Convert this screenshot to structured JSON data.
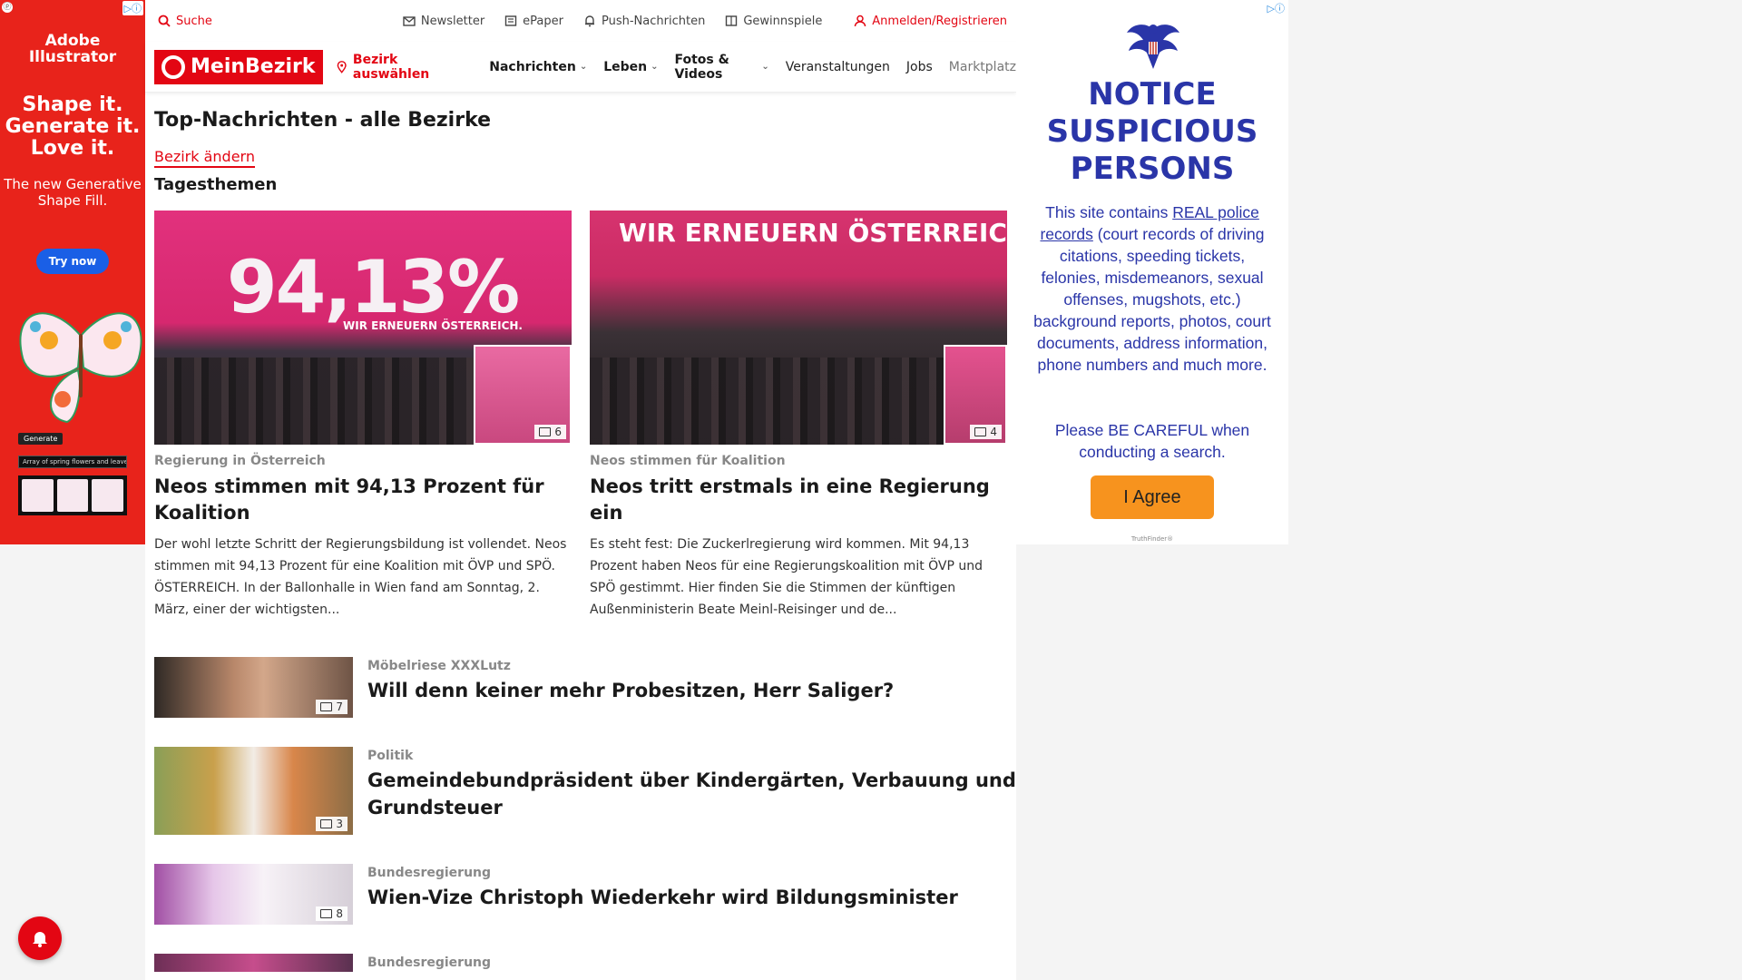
{
  "left_ad": {
    "adchoice": "▷ⓘ",
    "brand_line1": "Adobe",
    "brand_line2": "Illustrator",
    "headline": "Shape it. Generate it. Love it.",
    "sub": "The new Generative Shape Fill.",
    "cta": "Try now",
    "generate": "Generate",
    "prompt": "Array of spring flowers and leaves"
  },
  "utility": {
    "search": "Suche",
    "newsletter": "Newsletter",
    "epaper": "ePaper",
    "push": "Push-Nachrichten",
    "gewinnspiele": "Gewinnspiele",
    "login": "Anmelden/Registrieren"
  },
  "nav": {
    "logo": "MeinBezirk",
    "bezirk": "Bezirk auswählen",
    "items": [
      {
        "label": "Nachrichten"
      },
      {
        "label": "Leben"
      },
      {
        "label": "Fotos & Videos"
      },
      {
        "label": "Veranstaltungen"
      },
      {
        "label": "Jobs"
      },
      {
        "label": "Marktplatz"
      }
    ]
  },
  "main": {
    "title": "Top-Nachrichten - alle Bezirke",
    "change_link": "Bezirk ändern",
    "section": "Tagesthemen",
    "cards": [
      {
        "image_text": "94,13%",
        "image_slogan": "WIR ERNEUERN ÖSTERREICH.",
        "photo_count": "6",
        "kicker": "Regierung in Österreich",
        "title": "Neos stimmen mit 94,13 Prozent für Koalition",
        "teaser": "Der wohl letzte Schritt der Regierungsbildung ist vollendet. Neos stimmen mit 94,13 Prozent für eine Koalition mit ÖVP und SPÖ. ÖSTERREICH. In der Ballonhalle in Wien fand am Sonntag, 2. März, einer der wichtigsten..."
      },
      {
        "image_text": "WIR ERNEUERN ÖSTERREICH",
        "photo_count": "4",
        "kicker": "Neos stimmen für Koalition",
        "title": "Neos tritt erstmals in eine Regierung ein",
        "teaser": "Es steht fest: Die Zuckerlregierung wird kommen. Mit 94,13 Prozent haben Neos für eine Regierungskoalition mit ÖVP und SPÖ gestimmt. Hier finden Sie die Stimmen der künftigen Außenministerin Beate Meinl-Reisinger und de..."
      }
    ],
    "list": [
      {
        "kicker": "Möbelriese XXXLutz",
        "title": "Will denn keiner mehr Probesitzen, Herr Saliger?",
        "photo_count": "7"
      },
      {
        "kicker": "Politik",
        "title": "Gemeindebundpräsident über Kindergärten, Verbauung und Grundsteuer",
        "photo_count": "3"
      },
      {
        "kicker": "Bundesregierung",
        "title": "Wien-Vize Christoph Wiederkehr wird Bildungsminister",
        "photo_count": "8"
      },
      {
        "kicker": "Bundesregierung",
        "title": "",
        "photo_count": ""
      }
    ]
  },
  "right_ad": {
    "adchoice": "▷ⓘ",
    "notice": "NOTICE SUSPICIOUS PERSONS",
    "body_pre": "This site contains ",
    "body_link": "REAL police records",
    "body_post": " (court records of driving citations, speeding tickets, felonies, misdemeanors, sexual offenses, mugshots, etc.) background reports, photos, court documents, address information, phone numbers and much more.",
    "careful": "Please BE CAREFUL when conducting a search.",
    "cta": "I Agree",
    "footer": "TruthFinder®"
  },
  "colors": {
    "brand_red": "#e30613",
    "ad_blue": "#2a35a8",
    "ad_orange": "#f7931e"
  }
}
